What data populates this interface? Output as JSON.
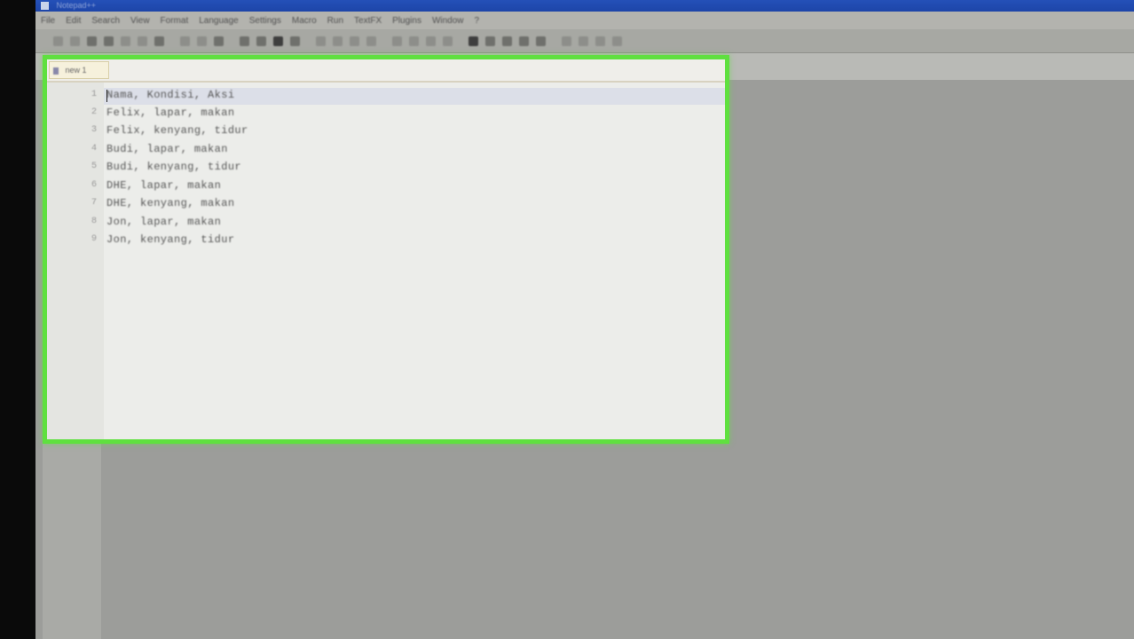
{
  "window": {
    "title": "Notepad++"
  },
  "menu": {
    "items": [
      "File",
      "Edit",
      "Search",
      "View",
      "Format",
      "Language",
      "Settings",
      "Macro",
      "Run",
      "TextFX",
      "Plugins",
      "Window",
      "?"
    ]
  },
  "tab": {
    "label": "new 1"
  },
  "editor": {
    "lines": [
      {
        "number": "1",
        "text": "Nama, Kondisi, Aksi"
      },
      {
        "number": "2",
        "text": "Felix, lapar, makan"
      },
      {
        "number": "3",
        "text": "Felix, kenyang, tidur"
      },
      {
        "number": "4",
        "text": "Budi, lapar, makan"
      },
      {
        "number": "5",
        "text": "Budi, kenyang, tidur"
      },
      {
        "number": "6",
        "text": "DHE, lapar, makan"
      },
      {
        "number": "7",
        "text": "DHE, kenyang, makan"
      },
      {
        "number": "8",
        "text": "Jon, lapar, makan"
      },
      {
        "number": "9",
        "text": "Jon, kenyang, tidur"
      }
    ]
  },
  "colors": {
    "highlight": "#5fe03f",
    "title_bar": "#1d45a8"
  }
}
